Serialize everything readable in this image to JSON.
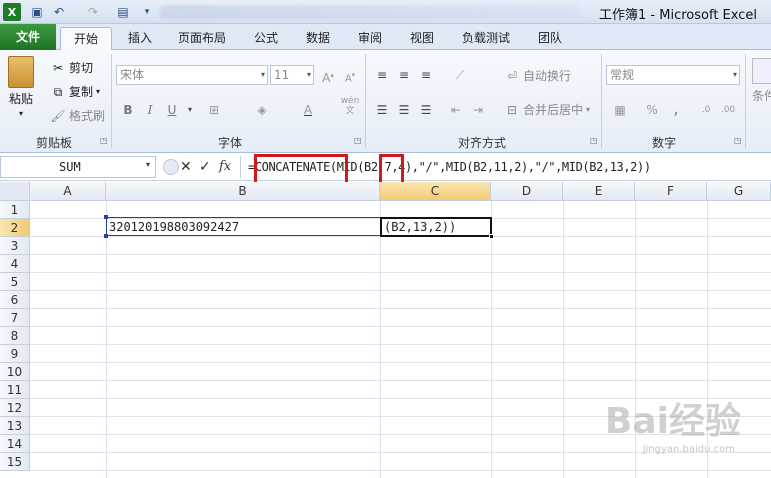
{
  "window": {
    "title": "工作簿1 - Microsoft Excel"
  },
  "tabs": [
    "文件",
    "开始",
    "插入",
    "页面布局",
    "公式",
    "数据",
    "审阅",
    "视图",
    "负载测试",
    "团队"
  ],
  "ribbon": {
    "clipboard": {
      "paste": "粘贴",
      "cut": "剪切",
      "copy": "复制",
      "format_painter": "格式刷",
      "label": "剪贴板"
    },
    "font": {
      "font_name": "宋体",
      "font_size": "11",
      "bold": "B",
      "italic": "I",
      "underline": "U",
      "label": "字体",
      "pinyin": "wén"
    },
    "alignment": {
      "wrap_text": "自动换行",
      "merge_center": "合并后居中",
      "label": "对齐方式"
    },
    "number": {
      "format": "常规",
      "label": "数字",
      "percent": "%",
      "comma": ","
    },
    "styles": {
      "conditional": "条件"
    }
  },
  "formula_bar": {
    "name_box": "SUM",
    "cancel": "✕",
    "enter": "✓",
    "fx": "fx",
    "formula": "=CONCATENATE(MID(B2,7,4),\"/\",MID(B2,11,2),\"/\",MID(B2,13,2))"
  },
  "sheet": {
    "columns": [
      "A",
      "B",
      "C",
      "D",
      "E",
      "F",
      "G"
    ],
    "rows": [
      "1",
      "2",
      "3",
      "4",
      "5",
      "6",
      "7",
      "8",
      "9",
      "10",
      "11",
      "12",
      "13",
      "14",
      "15"
    ],
    "cells": {
      "B2": "320120198803092427",
      "C2": "(B2,13,2))"
    }
  },
  "watermark": {
    "text": "Bai经验",
    "sub": "jingyan.baidu.com"
  },
  "colors": {
    "file_tab": "#2a8a30",
    "highlight": "#d0191b",
    "ribbon_bg": "#e6edf7"
  }
}
